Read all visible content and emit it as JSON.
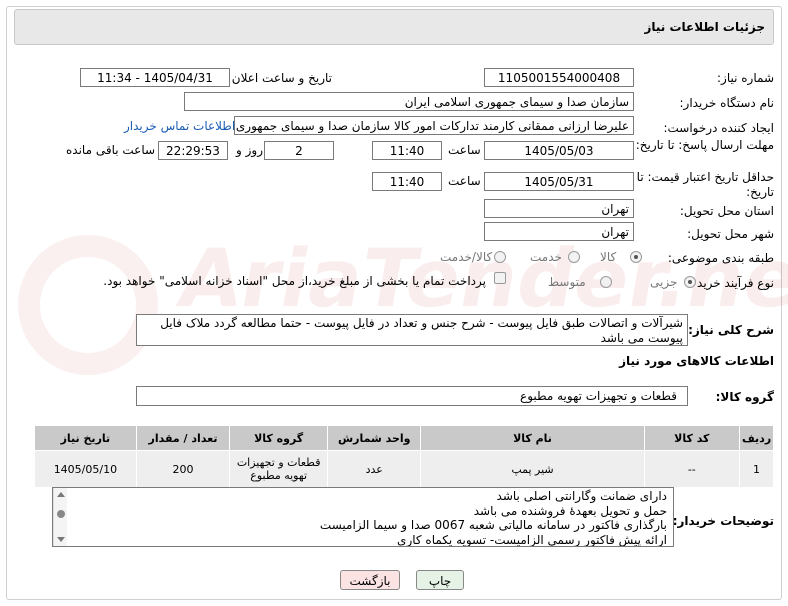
{
  "header": {
    "title": "جزئیات اطلاعات نیاز"
  },
  "form": {
    "need_number_label": "شماره نیاز:",
    "need_number": "1105001554000408",
    "announce_label": "تاریخ و ساعت اعلان عمومی:",
    "announce_value": "1405/04/31 - 11:34",
    "buyer_org_label": "نام دستگاه خریدار:",
    "buyer_org": "سازمان صدا و سیمای جمهوری اسلامی ایران",
    "creator_label": "ایجاد کننده درخواست:",
    "creator": "علیرضا ارزانی ممقانی کارمند تدارکات امور کالا سازمان صدا و سیمای جمهوری ا",
    "contact_link": "اطلاعات تماس خریدار",
    "deadline_label": "مهلت ارسال پاسخ: تا تاریخ:",
    "deadline_date": "1405/05/03",
    "time_label": "ساعت",
    "deadline_time": "11:40",
    "days_value": "2",
    "days_label": "روز و",
    "remaining_time": "22:29:53",
    "remaining_label": "ساعت باقی مانده",
    "min_price_label": "حداقل تاریخ اعتبار قیمت: تا تاریخ:",
    "min_price_date": "1405/05/31",
    "min_price_time": "11:40",
    "province_label": "استان محل تحویل:",
    "province": "تهران",
    "city_label": "شهر محل تحویل:",
    "city": "تهران",
    "category_label": "طبقه بندی موضوعی:",
    "category_options": [
      "کالا",
      "خدمت",
      "کالا/خدمت"
    ],
    "process_label": "نوع فرآیند خرید :",
    "process_options": [
      "جزیی",
      "متوسط"
    ],
    "payment_text": "پرداخت تمام یا بخشی از مبلغ خرید،از محل \"اسناد خزانه اسلامی\" خواهد بود.",
    "summary_label": "شرح کلی نیاز:",
    "summary_text": "شیرآلات و اتصالات طبق فایل پیوست - شرح جنس و تعداد در فایل پیوست - حتما مطالعه گردد ملاک فایل پیوست می باشد",
    "goods_info_title": "اطلاعات کالاهای مورد نیاز",
    "goods_group_label": "گروه کالا:",
    "goods_group": "قطعات و تجهیزات تهویه مطبوع"
  },
  "table": {
    "headers": [
      "ردیف",
      "کد کالا",
      "نام کالا",
      "واحد شمارش",
      "گروه کالا",
      "تعداد / مقدار",
      "تاریخ نیاز"
    ],
    "rows": [
      [
        "1",
        "--",
        "شیر پمپ",
        "عدد",
        "قطعات و تجهیزات تهویه مطبوع",
        "200",
        "1405/05/10"
      ]
    ]
  },
  "buyer_notes": {
    "label": "توضیحات خریدار:",
    "lines": [
      "دارای ضمانت وگارانتی اصلی باشد",
      "حمل و تحویل بعهدهٔ فروشنده می باشد",
      "بارگذاری فاکتور در سامانه مالیاتی شعبه 0067 صدا و سیما الزامیست",
      "ارائه پیش فاکتور رسمی الزامیست- تسویه یکماه کاری"
    ]
  },
  "buttons": {
    "print": "چاپ",
    "back": "بازگشت"
  },
  "colors": {
    "back_bg": "#fbe3e3",
    "print_bg": "#e6f2e6",
    "header_bg": "#e8e8e8",
    "table_header": "#c9c9c9",
    "link": "#1a5db5"
  }
}
